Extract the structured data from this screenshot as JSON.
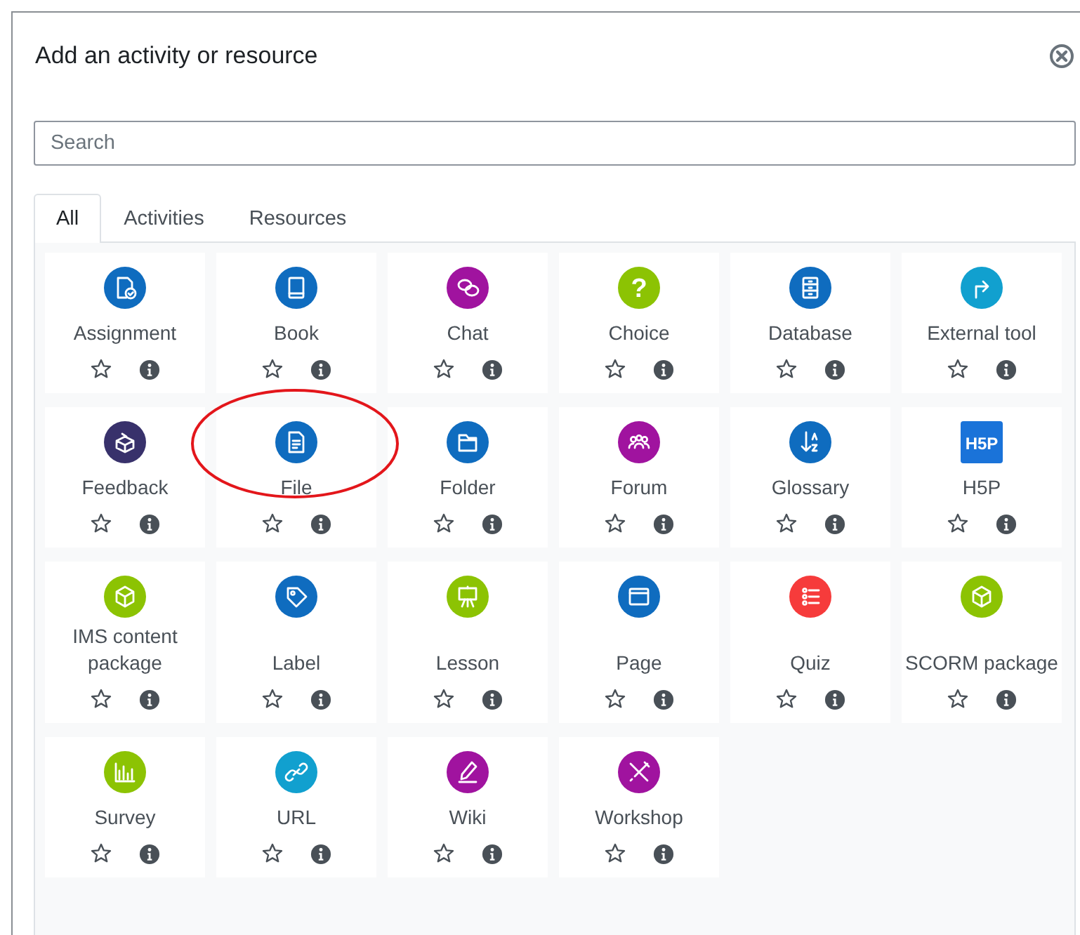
{
  "dialog": {
    "title": "Add an activity or resource"
  },
  "search": {
    "placeholder": "Search"
  },
  "tabs": [
    {
      "label": "All",
      "selected": true
    },
    {
      "label": "Activities",
      "selected": false
    },
    {
      "label": "Resources",
      "selected": false
    }
  ],
  "items": [
    {
      "name": "Assignment",
      "kind": "assignment",
      "color": "#0f6cbf",
      "starred": false,
      "highlighted": false
    },
    {
      "name": "Book",
      "kind": "book",
      "color": "#0f6cbf",
      "starred": false,
      "highlighted": false
    },
    {
      "name": "Chat",
      "kind": "chat",
      "color": "#a0139f",
      "starred": false,
      "highlighted": false
    },
    {
      "name": "Choice",
      "kind": "choice",
      "color": "#8cc303",
      "logo_text": "?",
      "starred": false,
      "highlighted": false
    },
    {
      "name": "Database",
      "kind": "database",
      "color": "#0f6cbf",
      "starred": false,
      "highlighted": false
    },
    {
      "name": "External tool",
      "kind": "external",
      "color": "#11a0cf",
      "starred": false,
      "highlighted": false
    },
    {
      "name": "Feedback",
      "kind": "feedback",
      "color": "#38316b",
      "starred": false,
      "highlighted": false
    },
    {
      "name": "File",
      "kind": "file",
      "color": "#0f6cbf",
      "starred": false,
      "highlighted": true
    },
    {
      "name": "Folder",
      "kind": "folder",
      "color": "#0f6cbf",
      "starred": false,
      "highlighted": false
    },
    {
      "name": "Forum",
      "kind": "forum",
      "color": "#a0139f",
      "starred": false,
      "highlighted": false
    },
    {
      "name": "Glossary",
      "kind": "glossary",
      "color": "#0f6cbf",
      "starred": false,
      "highlighted": false
    },
    {
      "name": "H5P",
      "kind": "h5p",
      "color": "#1a73d9",
      "logo_text": "H5P",
      "starred": false,
      "highlighted": false
    },
    {
      "name": "IMS content package",
      "kind": "cube",
      "color": "#8cc303",
      "starred": false,
      "highlighted": false
    },
    {
      "name": "Label",
      "kind": "label",
      "color": "#0f6cbf",
      "starred": false,
      "highlighted": false
    },
    {
      "name": "Lesson",
      "kind": "lesson",
      "color": "#8cc303",
      "starred": false,
      "highlighted": false
    },
    {
      "name": "Page",
      "kind": "page",
      "color": "#0f6cbf",
      "starred": false,
      "highlighted": false
    },
    {
      "name": "Quiz",
      "kind": "quiz",
      "color": "#f63b3b",
      "starred": false,
      "highlighted": false
    },
    {
      "name": "SCORM package",
      "kind": "cube",
      "color": "#8cc303",
      "starred": false,
      "highlighted": false
    },
    {
      "name": "Survey",
      "kind": "survey",
      "color": "#8cc303",
      "starred": false,
      "highlighted": false
    },
    {
      "name": "URL",
      "kind": "url",
      "color": "#11a0cf",
      "starred": false,
      "highlighted": false
    },
    {
      "name": "Wiki",
      "kind": "wiki",
      "color": "#a0139f",
      "starred": false,
      "highlighted": false
    },
    {
      "name": "Workshop",
      "kind": "workshop",
      "color": "#a0139f",
      "starred": false,
      "highlighted": false
    }
  ]
}
